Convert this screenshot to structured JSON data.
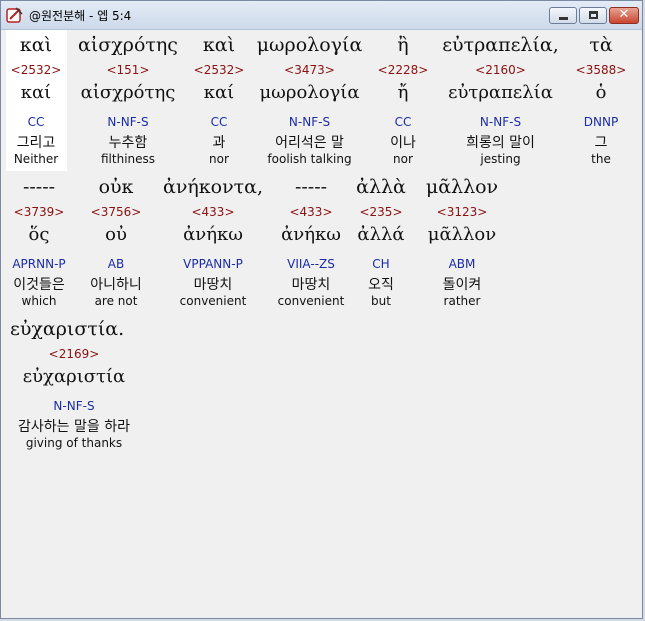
{
  "window": {
    "title": "@원전분해 - 엡 5:4"
  },
  "rows": [
    [
      {
        "greek": "καὶ",
        "strong": "<2532>",
        "lemma": "καί",
        "morph": "CC",
        "korean": "그리고",
        "english": "Neither"
      },
      {
        "greek": "αἰσχρότης",
        "strong": "<151>",
        "lemma": "αἰσχρότης",
        "morph": "N-NF-S",
        "korean": "누추함",
        "english": "filthiness"
      },
      {
        "greek": "καὶ",
        "strong": "<2532>",
        "lemma": "καί",
        "morph": "CC",
        "korean": "과",
        "english": "nor"
      },
      {
        "greek": "μωρολογία",
        "strong": "<3473>",
        "lemma": "μωρολογία",
        "morph": "N-NF-S",
        "korean": "어리석은 말",
        "english": "foolish talking"
      },
      {
        "greek": "ἢ",
        "strong": "<2228>",
        "lemma": "ἤ",
        "morph": "CC",
        "korean": "이나",
        "english": "nor"
      },
      {
        "greek": "εὐτραπελία,",
        "strong": "<2160>",
        "lemma": "εὐτραπελία",
        "morph": "N-NF-S",
        "korean": "희롱의 말이",
        "english": "jesting"
      },
      {
        "greek": "τὰ",
        "strong": "<3588>",
        "lemma": "ὁ",
        "morph": "DNNP",
        "korean": "그",
        "english": "the"
      }
    ],
    [
      {
        "greek": "-----",
        "strong": "<3739>",
        "lemma": "ὅς",
        "morph": "APRNN-P",
        "korean": "이것들은",
        "english": "which"
      },
      {
        "greek": "οὐκ",
        "strong": "<3756>",
        "lemma": "οὐ",
        "morph": "AB",
        "korean": "아니하니",
        "english": "are not"
      },
      {
        "greek": "ἀνήκοντα,",
        "strong": "<433>",
        "lemma": "ἀνήκω",
        "morph": "VPPANN-P",
        "korean": "마땅치",
        "english": "convenient"
      },
      {
        "greek": "-----",
        "strong": "<433>",
        "lemma": "ἀνήκω",
        "morph": "VIIA--ZS",
        "korean": "마땅치",
        "english": "convenient"
      },
      {
        "greek": "ἀλλὰ",
        "strong": "<235>",
        "lemma": "ἀλλά",
        "morph": "CH",
        "korean": "오직",
        "english": "but"
      },
      {
        "greek": "μᾶλλον",
        "strong": "<3123>",
        "lemma": "μᾶλλον",
        "morph": "ABM",
        "korean": "돌이켜",
        "english": "rather"
      }
    ],
    [
      {
        "greek": "εὐχαριστία.",
        "strong": "<2169>",
        "lemma": "εὐχαριστία",
        "morph": "N-NF-S",
        "korean": "감사하는 말을 하라",
        "english": "giving of thanks"
      }
    ]
  ]
}
